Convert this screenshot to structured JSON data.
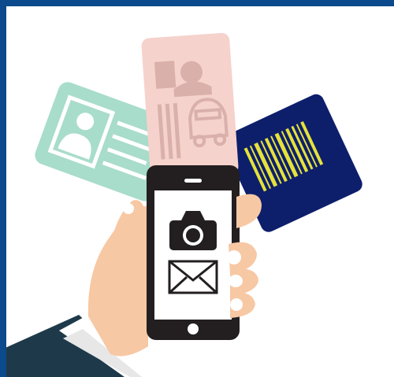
{
  "illustration": {
    "subject": "hand-holding-smartphone-with-id-cards",
    "icons": [
      "camera-icon",
      "envelope-icon"
    ],
    "cards": [
      "id-card",
      "driver-license-card",
      "barcode-card"
    ],
    "colors": {
      "border": "#0b4a8c",
      "id_card": "#a8dccb",
      "license_card": "#f6d2cd",
      "barcode_card": "#0d1f6b",
      "barcode_stripes": "#e6e23a",
      "phone_body": "#231f20",
      "phone_screen": "#ffffff",
      "skin": "#f7c8a4",
      "sleeve": "#1e3a4a",
      "cuff": "#ffffff"
    }
  }
}
